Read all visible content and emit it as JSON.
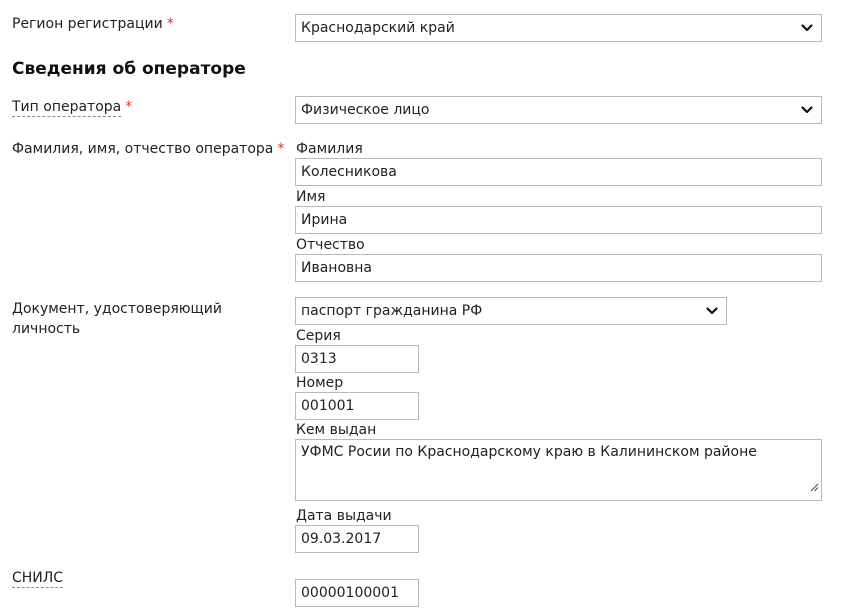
{
  "region": {
    "label": "Регион регистрации",
    "required_mark": "*",
    "value": "Краснодарский край"
  },
  "section_title": "Сведения об операторе",
  "operator_type": {
    "label": "Тип оператора",
    "required_mark": "*",
    "value": "Физическое лицо"
  },
  "full_name": {
    "label": "Фамилия, имя, отчество оператора",
    "required_mark": "*",
    "surname_label": "Фамилия",
    "surname_value": "Колесникова",
    "name_label": "Имя",
    "name_value": "Ирина",
    "patronymic_label": "Отчество",
    "patronymic_value": "Ивановна"
  },
  "identity_document": {
    "label_line1": "Документ, удостоверяющий",
    "label_line2": "личность",
    "type_value": "паспорт гражданина РФ",
    "series_label": "Серия",
    "series_value": "0313",
    "number_label": "Номер",
    "number_value": "001001",
    "issued_by_label": "Кем выдан",
    "issued_by_value": "УФМС Росии по Краснодарскому краю в Калининском районе",
    "issue_date_label": "Дата выдачи",
    "issue_date_value": "09.03.2017"
  },
  "snils": {
    "label": "СНИЛС",
    "value": "00000100001"
  },
  "icons": {
    "select_arrow": "chevron-down-icon",
    "textarea_resize": "resize-grip-icon"
  }
}
